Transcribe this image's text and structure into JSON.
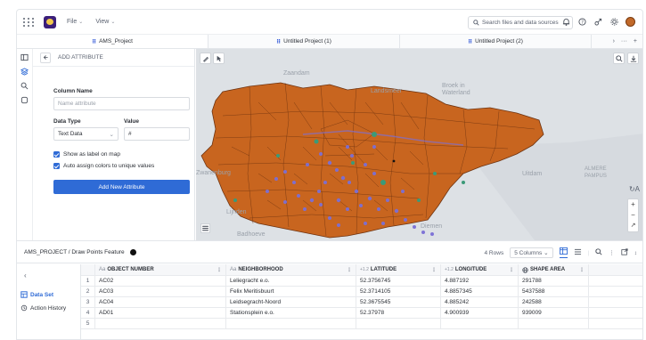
{
  "topbar": {
    "menu": [
      {
        "label": "File"
      },
      {
        "label": "View"
      }
    ],
    "search_placeholder": "Search files and data sources"
  },
  "tabs": [
    {
      "label": "AMS_Project",
      "active": true
    },
    {
      "label": "Untitled Project (1)",
      "active": false
    },
    {
      "label": "Untitled Project (2)",
      "active": false
    }
  ],
  "tab_controls": {
    "more": "···",
    "add": "+"
  },
  "panel": {
    "title": "ADD ATTRIBUTE",
    "column_name_label": "Column Name",
    "column_name_placeholder": "Name attribute",
    "data_type_label": "Data Type",
    "data_type_value": "Text Data",
    "value_label": "Value",
    "value_value": "#",
    "checkboxes": [
      {
        "label": "Show as label on map",
        "checked": true
      },
      {
        "label": "Auto assign colors to unique values",
        "checked": true
      }
    ],
    "submit_label": "Add New Attribute"
  },
  "map": {
    "place_labels": [
      "Zaandam",
      "Landsmeer",
      "Broek in Waterland",
      "Zwanenburg",
      "Lijnden",
      "Badhoeve",
      "Diemen",
      "Uitdam",
      "ALMERE PAMPUS"
    ],
    "fill_color": "#c8651f",
    "water_color": "#dde1e5",
    "point_color": "#7b6fd6",
    "zoom_in": "+",
    "zoom_out": "−"
  },
  "feature_bar": {
    "breadcrumb": "AMS_PROJECT / Draw Points Feature",
    "rows": "4 Rows",
    "columns_select": "5 Columns"
  },
  "data_nav": {
    "items": [
      {
        "label": "Data Set",
        "active": true
      },
      {
        "label": "Action History",
        "active": false
      }
    ]
  },
  "table": {
    "columns": [
      {
        "label": "OBJECT NUMBER",
        "type_icon": "Aa"
      },
      {
        "label": "NEIGHBORHOOD",
        "type_icon": "Aa"
      },
      {
        "label": "LATITUDE",
        "type_icon": "+1.2"
      },
      {
        "label": "LONGITUDE",
        "type_icon": "+1.2"
      },
      {
        "label": "SHAPE AREA",
        "type_icon": "globe"
      }
    ],
    "rows": [
      {
        "n": "1",
        "cells": [
          "AC02",
          "Leliegracht e.o.",
          "52.3756745",
          "4.887192",
          "291788"
        ]
      },
      {
        "n": "2",
        "cells": [
          "AC03",
          "Felix Meritisbuurt",
          "52.3714105",
          "4.8857345",
          "5437588"
        ]
      },
      {
        "n": "3",
        "cells": [
          "AC04",
          "Leidsegracht-Noord",
          "52.3675545",
          "4.885242",
          "242588"
        ]
      },
      {
        "n": "4",
        "cells": [
          "AD01",
          "Stationsplein e.o.",
          "52.37978",
          "4.900939",
          "939009"
        ]
      },
      {
        "n": "5",
        "cells": [
          "",
          "",
          "",
          "",
          ""
        ]
      }
    ]
  }
}
